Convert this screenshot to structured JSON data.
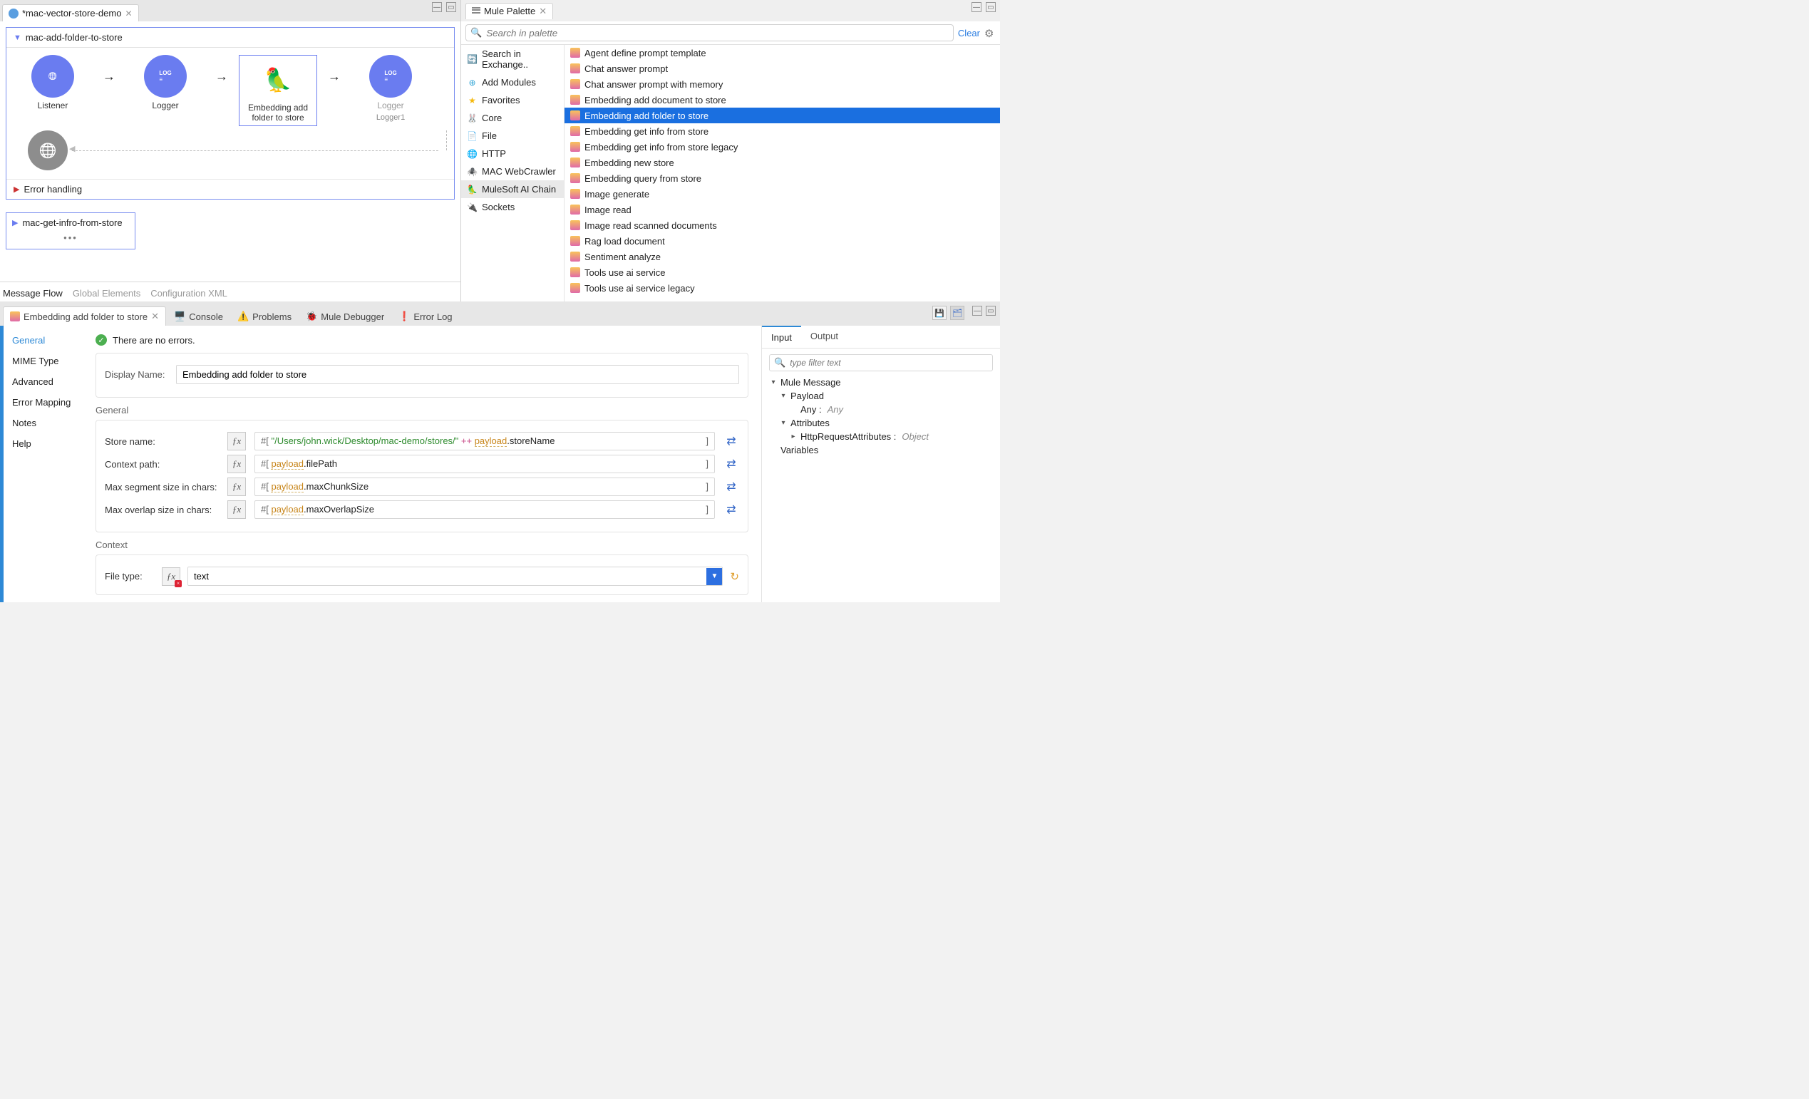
{
  "editor": {
    "tab_title": "*mac-vector-store-demo",
    "flow_name": "mac-add-folder-to-store",
    "nodes": {
      "listener": "Listener",
      "logger": "Logger",
      "embedding_add": "Embedding add folder to store",
      "logger2": "Logger",
      "logger2_sub": "Logger1"
    },
    "error_handling": "Error handling",
    "second_flow": "mac-get-infro-from-store",
    "footer_tabs": {
      "message_flow": "Message Flow",
      "global_elements": "Global Elements",
      "config_xml": "Configuration XML"
    }
  },
  "palette": {
    "view_title": "Mule Palette",
    "search_placeholder": "Search in palette",
    "clear": "Clear",
    "categories": [
      "Search in Exchange..",
      "Add Modules",
      "Favorites",
      "Core",
      "File",
      "HTTP",
      "MAC WebCrawler",
      "MuleSoft AI Chain",
      "Sockets"
    ],
    "selected_category_index": 7,
    "operations": [
      "Agent define prompt template",
      "Chat answer prompt",
      "Chat answer prompt with memory",
      "Embedding add document to store",
      "Embedding add folder to store",
      "Embedding get info from store",
      "Embedding get info from store legacy",
      "Embedding new store",
      "Embedding query from store",
      "Image generate",
      "Image read",
      "Image read scanned documents",
      "Rag load document",
      "Sentiment analyze",
      "Tools use ai service",
      "Tools use ai service legacy"
    ],
    "selected_operation_index": 4
  },
  "properties": {
    "tab_title": "Embedding add folder to store",
    "other_tabs": [
      "Console",
      "Problems",
      "Mule Debugger",
      "Error Log"
    ],
    "status_msg": "There are no errors.",
    "side_nav": [
      "General",
      "MIME Type",
      "Advanced",
      "Error Mapping",
      "Notes",
      "Help"
    ],
    "display_name_label": "Display Name:",
    "display_name_value": "Embedding add folder to store",
    "general_header": "General",
    "fields": {
      "store_name": {
        "label": "Store name:",
        "prefix": "#[ ",
        "str": "\"/Users/john.wick/Desktop/mac-demo/stores/\"",
        "plus": "  ++ ",
        "ref": "payload",
        "tail": ".storeName",
        "suffix": " ]"
      },
      "context_path": {
        "label": "Context path:",
        "prefix": "#[ ",
        "ref": "payload",
        "tail": ".filePath",
        "suffix": " ]"
      },
      "max_seg": {
        "label": "Max segment size in chars:",
        "prefix": "#[ ",
        "ref": "payload",
        "tail": ".maxChunkSize",
        "suffix": " ]"
      },
      "max_overlap": {
        "label": "Max overlap size in chars:",
        "prefix": "#[ ",
        "ref": "payload",
        "tail": ".maxOverlapSize",
        "suffix": " ]"
      }
    },
    "context_header": "Context",
    "file_type_label": "File type:",
    "file_type_value": "text"
  },
  "datasense": {
    "tabs": {
      "input": "Input",
      "output": "Output"
    },
    "filter_placeholder": "type filter text",
    "tree": {
      "mule_message": "Mule Message",
      "payload": "Payload",
      "payload_any": "Any :",
      "payload_any_type": "Any",
      "attributes": "Attributes",
      "http_attrs": "HttpRequestAttributes :",
      "http_attrs_type": "Object",
      "variables": "Variables"
    }
  }
}
